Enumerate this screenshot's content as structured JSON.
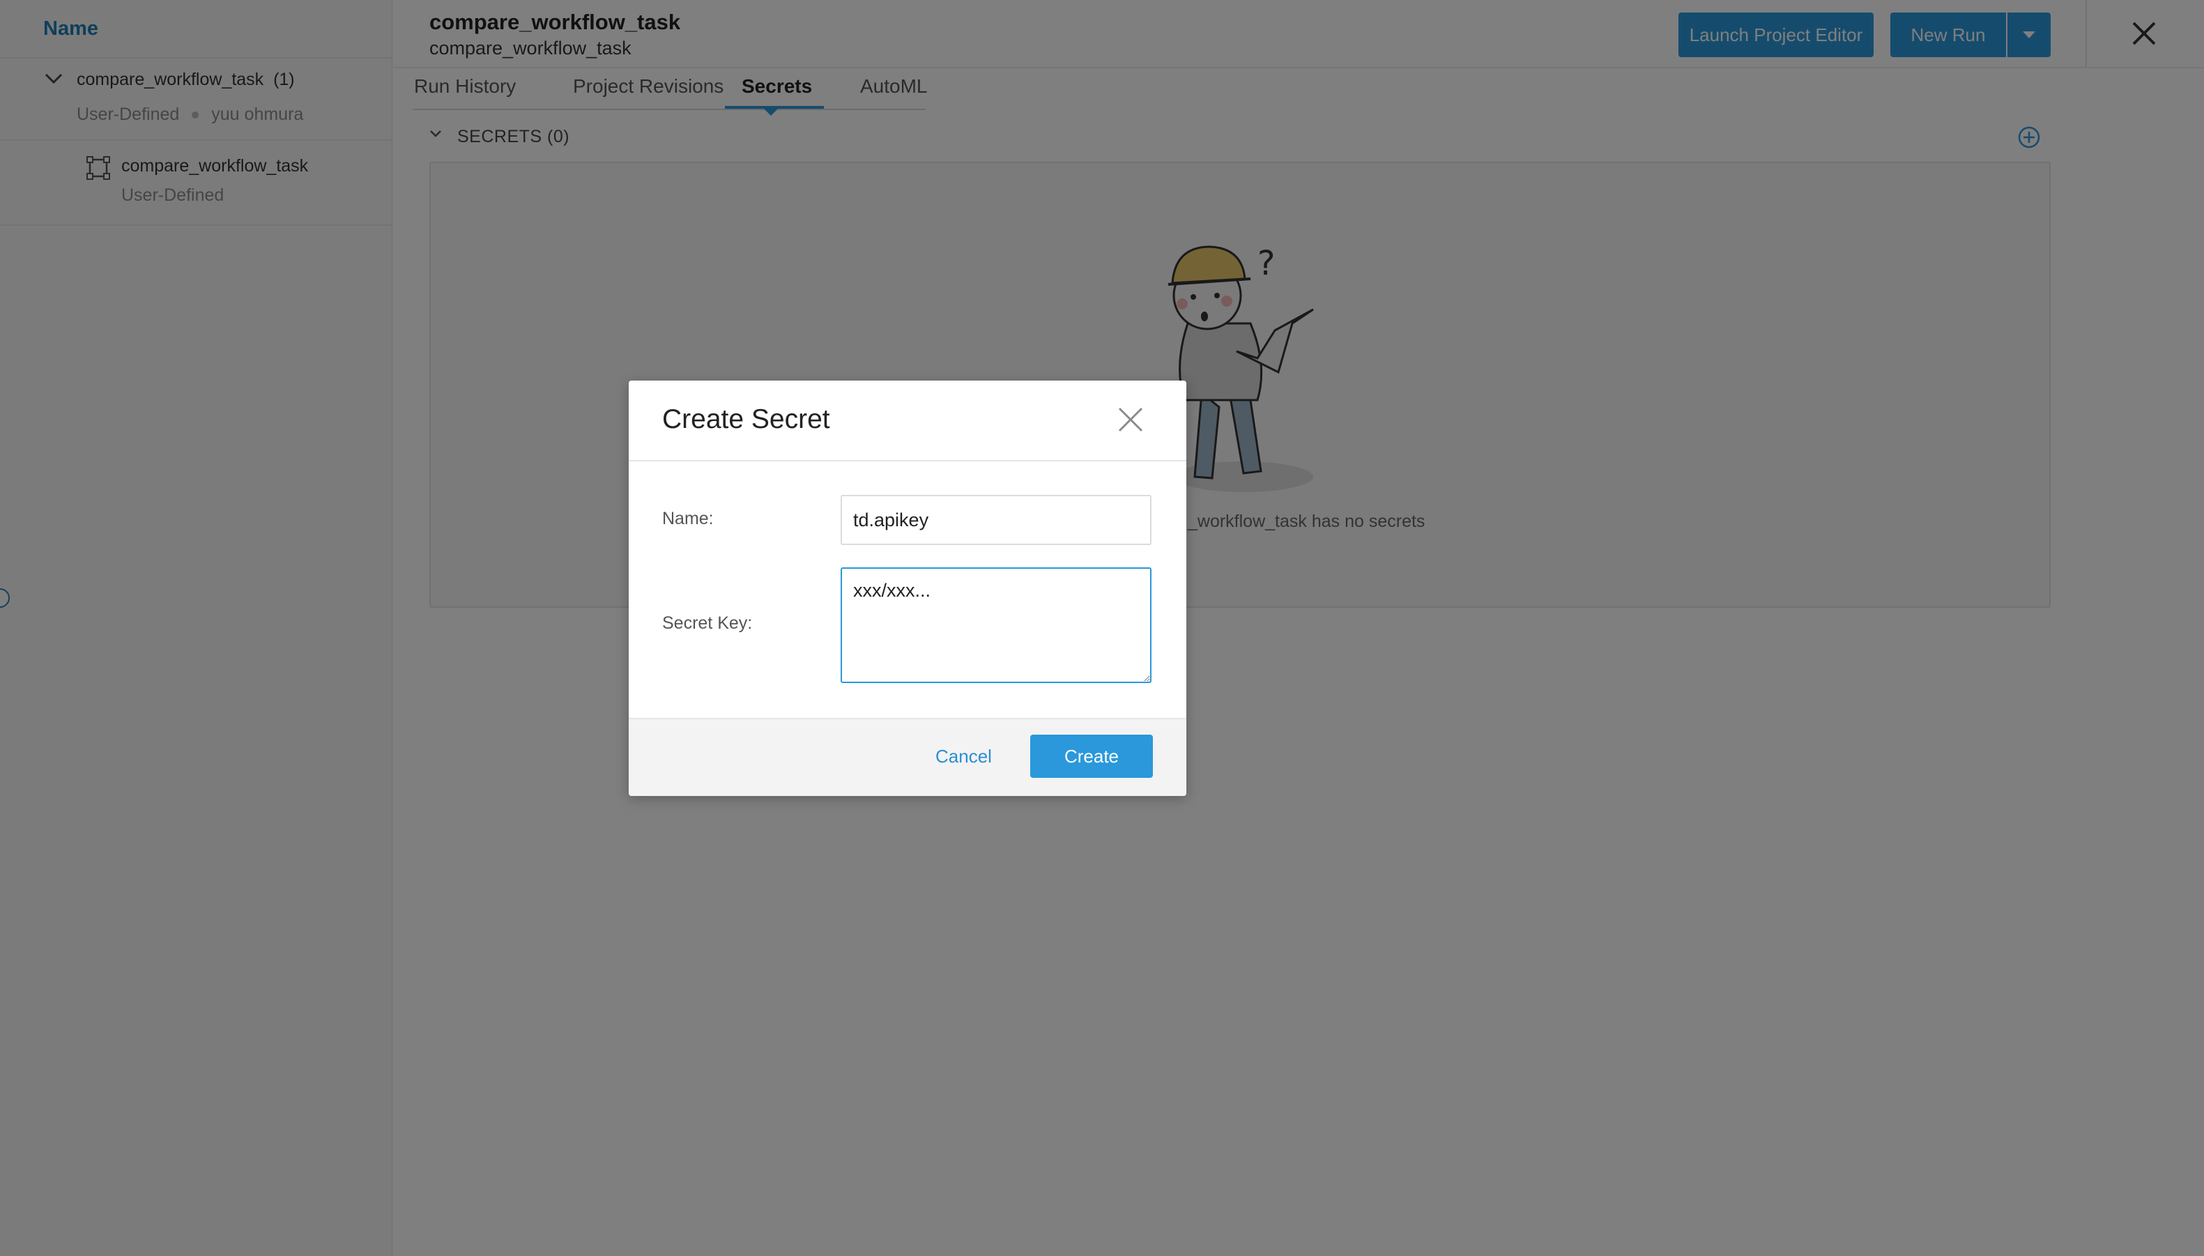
{
  "sidebar": {
    "header": "Name",
    "group": {
      "title": "compare_workflow_task",
      "count": "(1)",
      "type": "User-Defined",
      "owner": "yuu ohmura"
    },
    "workflow": {
      "title": "compare_workflow_task",
      "type": "User-Defined"
    }
  },
  "header": {
    "project_title": "compare_workflow_task",
    "project_subtitle": "compare_workflow_task",
    "launch_button": "Launch Project Editor",
    "new_run_button": "New Run"
  },
  "tabs": [
    {
      "label": "Run History",
      "active": false
    },
    {
      "label": "Project Revisions",
      "active": false
    },
    {
      "label": "Secrets",
      "active": true
    },
    {
      "label": "AutoML",
      "active": false
    }
  ],
  "secrets": {
    "section_label": "SECRETS (0)",
    "empty_message": "_workflow_task has no secrets"
  },
  "modal": {
    "title": "Create Secret",
    "name_label": "Name:",
    "name_value": "td.apikey",
    "secret_label": "Secret Key:",
    "secret_value": "xxx/xxx...",
    "cancel_label": "Cancel",
    "create_label": "Create"
  },
  "colors": {
    "accent": "#2a98db",
    "link": "#1f7fb5"
  },
  "icons": {
    "close": "close-icon",
    "add": "plus-circle-icon",
    "caret": "caret-down-icon",
    "chevron": "chevron-down-icon",
    "workflow": "workflow-icon"
  }
}
